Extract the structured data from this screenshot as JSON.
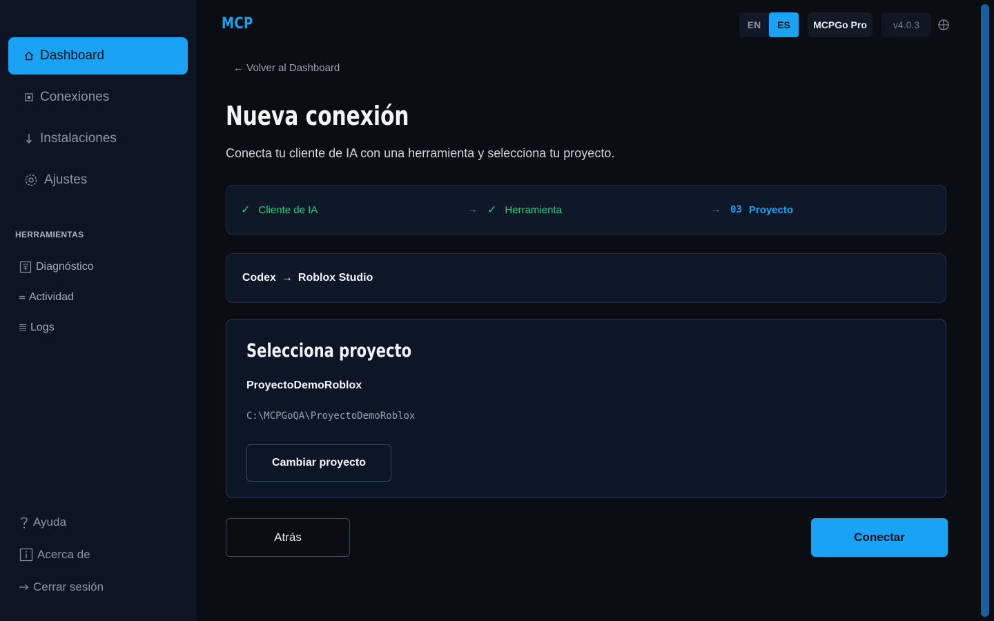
{
  "sidebar": {
    "main_nav": [
      {
        "label": "Dashboard",
        "icon": "home-icon",
        "active": true
      },
      {
        "label": "Conexiones",
        "icon": "connections-icon",
        "active": false
      },
      {
        "label": "Instalaciones",
        "icon": "download-icon",
        "active": false
      },
      {
        "label": "Ajustes",
        "icon": "gear-icon",
        "active": false
      }
    ],
    "tools_label": "HERRAMIENTAS",
    "tools": [
      {
        "label": "Diagnóstico",
        "icon": "diagnostics-icon"
      },
      {
        "label": "Actividad",
        "icon": "activity-icon"
      },
      {
        "label": "Logs",
        "icon": "logs-icon"
      }
    ],
    "bottom": [
      {
        "label": "Ayuda",
        "icon": "help-icon"
      },
      {
        "label": "Acerca de",
        "icon": "info-icon"
      },
      {
        "label": "Cerrar sesión",
        "icon": "logout-icon"
      }
    ]
  },
  "header": {
    "logo": "MCP",
    "languages": [
      "EN",
      "ES"
    ],
    "active_language": "ES",
    "plan": "MCPGo Pro",
    "version": "v4.0.3"
  },
  "main": {
    "back_link": "← Volver al Dashboard",
    "title": "Nueva conexión",
    "subtitle": "Conecta tu cliente de IA con una herramienta y selecciona tu proyecto.",
    "steps": [
      {
        "label": "Cliente de IA",
        "status": "done"
      },
      {
        "label": "Herramienta",
        "status": "done"
      },
      {
        "number": "03",
        "label": "Proyecto",
        "status": "current"
      }
    ],
    "connection_path": {
      "client": "Codex",
      "arrow": "→",
      "tool": "Roblox Studio"
    },
    "project_card": {
      "title": "Selecciona proyecto",
      "project_name": "ProyectoDemoRoblox",
      "project_path": "C:\\MCPGoQA\\ProyectoDemoRoblox",
      "change_label": "Cambiar proyecto"
    },
    "back_label": "Atrás",
    "connect_label": "Conectar"
  },
  "colors": {
    "accent": "#1aa3f5",
    "success": "#22d37f",
    "sidebar_bg": "#0d1525",
    "page_bg": "#0a0d12"
  }
}
